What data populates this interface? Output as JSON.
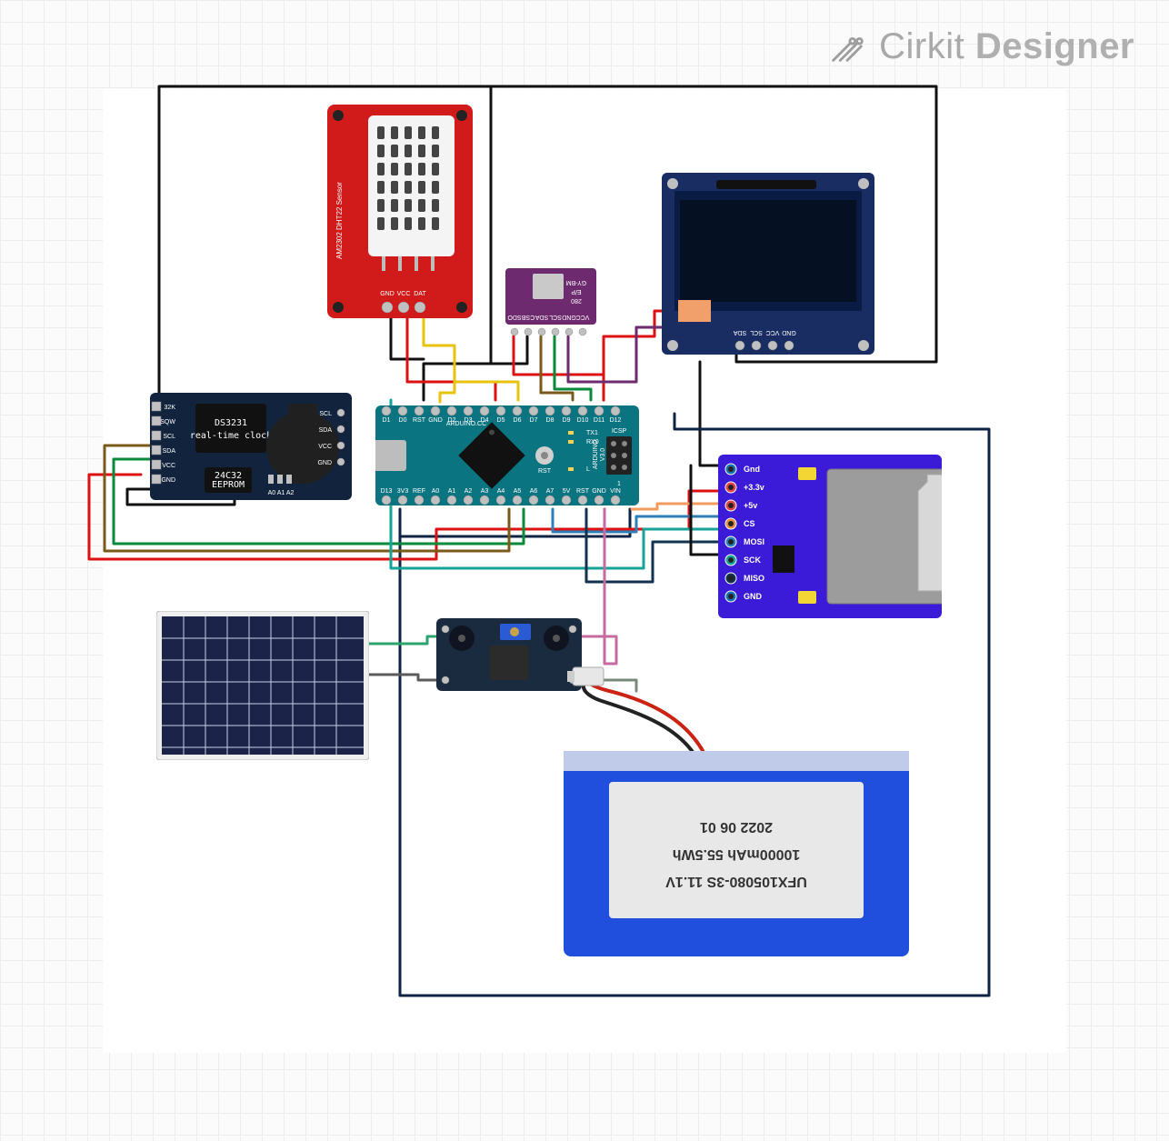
{
  "brand": {
    "part1": "Cirkit",
    "part2": "Designer"
  },
  "dht22": {
    "title_line1": "AM2302 DHT22 Sensor",
    "pins": [
      "GND",
      "VCC",
      "DAT"
    ]
  },
  "rtc": {
    "chip_label_line1": "DS3231",
    "chip_label_line2": "real-time clock",
    "mem_label_line1": "24C32",
    "mem_label_line2": "EEPROM",
    "left_pins": [
      "32K",
      "SQW",
      "SCL",
      "SDA",
      "VCC",
      "GND"
    ],
    "right_pins": [
      "SCL",
      "SDA",
      "VCC",
      "GND"
    ],
    "addr_labels": "A0 A1 A2"
  },
  "nano": {
    "digital_pins": [
      "D1",
      "D0",
      "RST",
      "GND",
      "D2",
      "D3",
      "D4",
      "D5",
      "D6",
      "D7",
      "D8",
      "D9",
      "D10",
      "D11",
      "D12"
    ],
    "analog_pins": [
      "D13",
      "3V3",
      "REF",
      "A0",
      "A1",
      "A2",
      "A3",
      "A4",
      "A5",
      "A6",
      "A7",
      "5V",
      "RST",
      "GND",
      "VIN"
    ],
    "brand_line1": "ARDUINO.CC",
    "brand_line2": "ARDUINO",
    "rst_label": "RST",
    "tx_label": "TX1",
    "rx_label": "RX0",
    "l_label": "L",
    "icsp_label": "ICSP",
    "ver_label": "V3.0",
    "one_label": "1"
  },
  "bmp": {
    "silk1": "GY-BM",
    "silk2": "E/P",
    "silk3": "280",
    "pins": [
      "VCC",
      "GND",
      "SCL",
      "SDA",
      "CSB",
      "SDO"
    ]
  },
  "oled": {
    "pins": [
      "GND",
      "VCC",
      "SCL",
      "SDA"
    ]
  },
  "sd": {
    "pins": [
      "Gnd",
      "+3.3v",
      "+5v",
      "CS",
      "MOSI",
      "SCK",
      "MISO",
      "GND"
    ]
  },
  "lipo": {
    "model": "UFX105080-3S 11.1V",
    "capacity": "10000mAh 55.5Wh",
    "date": "2022 06 01"
  }
}
